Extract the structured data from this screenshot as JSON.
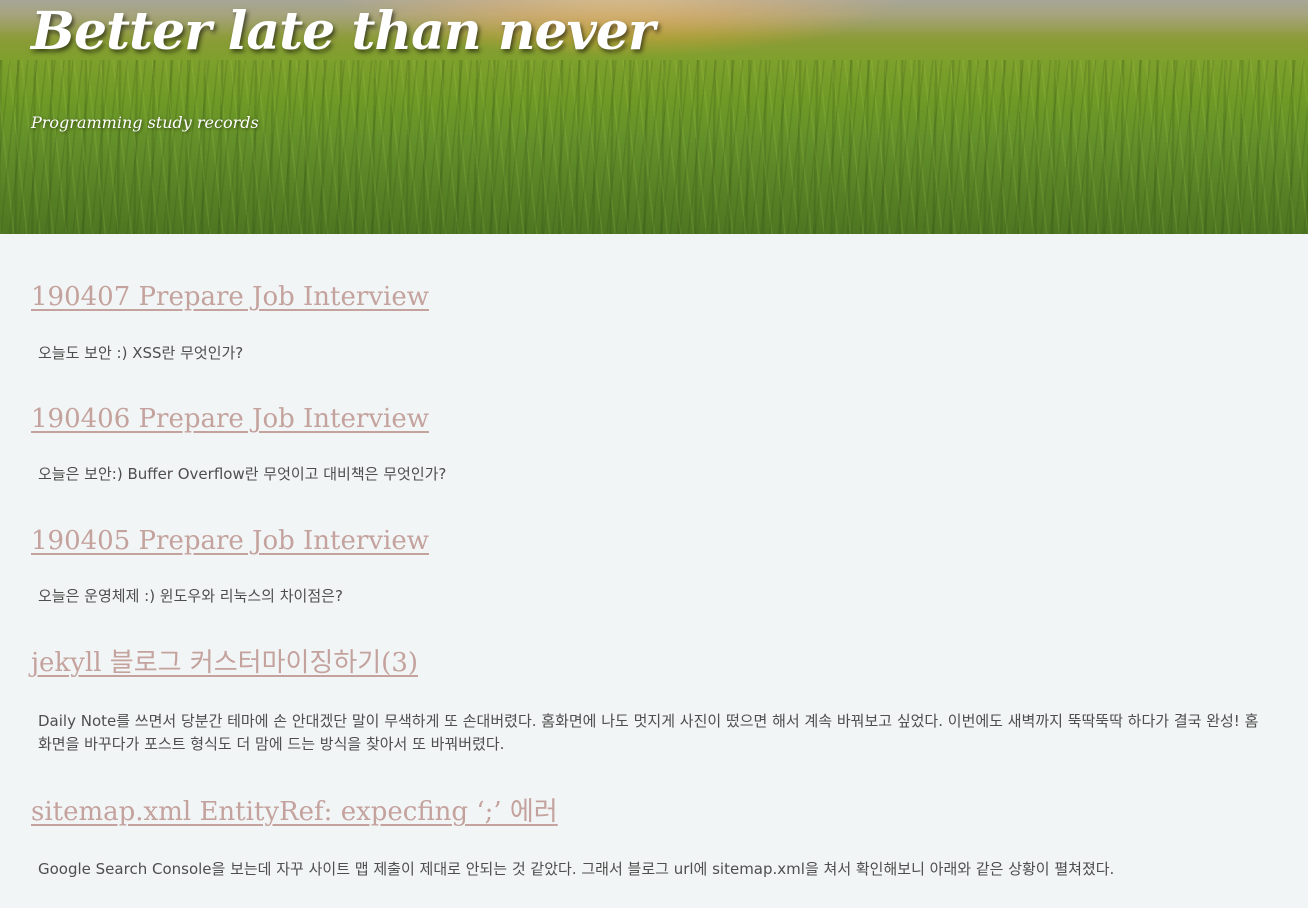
{
  "header": {
    "title": "Better late than never",
    "subtitle": "Programming study records"
  },
  "posts": [
    {
      "title": "190407   Prepare Job Interview",
      "excerpt": "오늘도 보안 :) XSS란 무엇인가?"
    },
    {
      "title": "190406   Prepare Job Interview",
      "excerpt": "오늘은 보안:) Buffer Overflow란 무엇이고 대비책은 무엇인가?"
    },
    {
      "title": "190405   Prepare Job Interview",
      "excerpt": "오늘은 운영체제 :) 윈도우와 리눅스의 차이점은?"
    },
    {
      "title": "jekyll 블로그 커스터마이징하기(3)",
      "excerpt": "Daily Note를 쓰면서 당분간 테마에 손 안대겠단 말이 무색하게 또 손대버렸다. 홈화면에 나도 멋지게 사진이 떴으면 해서 계속 바꿔보고 싶었다. 이번에도 새벽까지 뚝딱뚝딱 하다가 결국 완성! 홈화면을 바꾸다가 포스트 형식도 더 맘에 드는 방식을 찾아서 또 바꿔버렸다."
    },
    {
      "title": "sitemap.xml EntityRef: expecfing ‘;’ 에러",
      "excerpt": "Google Search Console을 보는데 자꾸 사이트 맵 제출이 제대로 안되는 것 같았다. 그래서 블로그 url에 sitemap.xml을 쳐서 확인해보니 아래와 같은 상황이 펼쳐졌다."
    }
  ],
  "colors": {
    "background": "#f2f5f6",
    "link": "#c4a29d",
    "text": "#4e4e4e",
    "header_text": "#ffffff"
  }
}
